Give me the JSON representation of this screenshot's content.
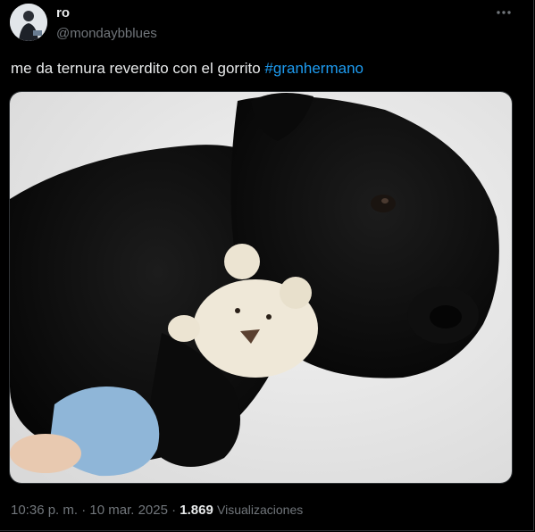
{
  "user": {
    "display_name": "ro",
    "handle": "@mondaybblues"
  },
  "tweet": {
    "text": "me da ternura reverdito con el gorrito ",
    "hashtag": "#granhermano"
  },
  "meta": {
    "time": "10:36 p. m.",
    "separator1": " · ",
    "date": "10 mar. 2025",
    "separator2": " · ",
    "views_count": "1.869",
    "views_label": "Visualizaciones"
  },
  "icons": {
    "more": "more-options-icon",
    "avatar": "avatar-image"
  },
  "colors": {
    "background": "#000000",
    "text_primary": "#e7e9ea",
    "text_secondary": "#71767b",
    "link": "#1d9bf0"
  }
}
